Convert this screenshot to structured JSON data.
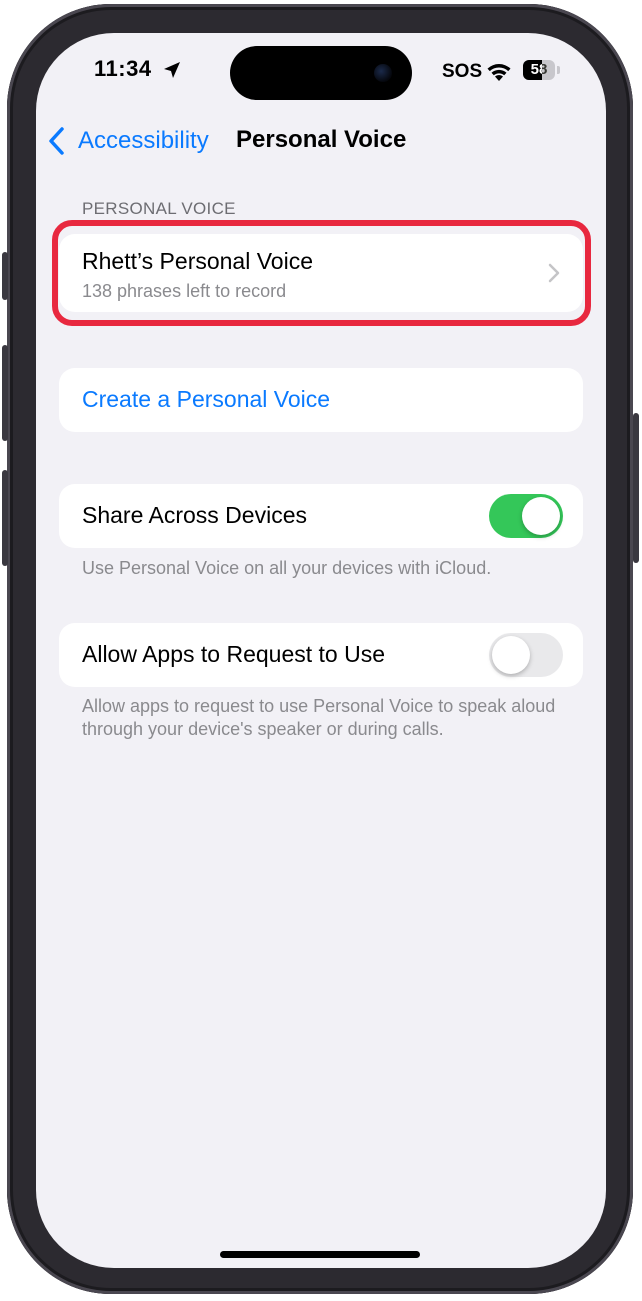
{
  "status_bar": {
    "time": "11:34",
    "carrier": "SOS",
    "battery_level": "58",
    "battery_fraction": 0.58
  },
  "nav": {
    "back_label": "Accessibility",
    "title": "Personal Voice"
  },
  "personal_voice_section": {
    "header": "PERSONAL VOICE",
    "voice_item": {
      "title": "Rhett’s Personal Voice",
      "subtitle": "138 phrases left to record"
    }
  },
  "create_voice": {
    "label": "Create a Personal Voice"
  },
  "share_across_devices": {
    "label": "Share Across Devices",
    "enabled": true,
    "footer": "Use Personal Voice on all your devices with iCloud."
  },
  "allow_apps": {
    "label": "Allow Apps to Request to Use",
    "enabled": false,
    "footer": "Allow apps to request to use Personal Voice to speak aloud through your device's speaker or during calls."
  },
  "colors": {
    "accent": "#0a7aff",
    "toggle_on": "#34c759",
    "toggle_off": "#e9e9eb",
    "highlight": "#e8283f",
    "background": "#f2f1f6"
  },
  "icons": [
    "location-arrow-icon",
    "wifi-icon",
    "battery-icon",
    "chevron-left-icon",
    "chevron-right-icon"
  ]
}
